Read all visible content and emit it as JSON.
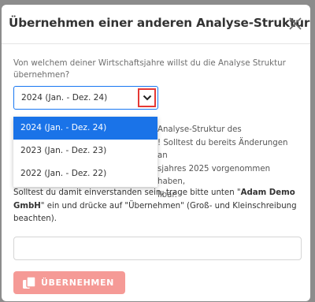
{
  "modal": {
    "title": "Übernehmen einer anderen Analyse-Struktur",
    "question": "Von welchem deiner Wirtschaftsjahre willst du die Analyse Struktur übernehmen?",
    "select": {
      "value": "2024 (Jan. - Dez. 24)",
      "options": [
        "2024 (Jan. - Dez. 24)",
        "2023 (Jan. - Dez. 23)",
        "2022 (Jan. - Dez. 22)"
      ]
    },
    "info": {
      "line1": "Analyse-Struktur des",
      "line2": "! Solltest du bereits Änderungen an",
      "line3": "sjahres 2025 vorgenommen haben,",
      "line4": "llbar."
    },
    "instruction": {
      "part1": "Solltest du damit einverstanden sein, trage bitte unten \"",
      "company": "Adam Demo GmbH",
      "part2": "\" ein und drücke auf \"Übernehmen\" (Groß- und Kleinschreibung beachten)."
    },
    "confirm_input": {
      "value": "",
      "placeholder": ""
    },
    "submit_label": "ÜBERNEHMEN"
  },
  "colors": {
    "accent": "#1877f2",
    "selected_option": "#1a73e8",
    "submit_button": "#f59a96",
    "highlight_border": "#e53935",
    "backdrop": "#8c8c8c"
  },
  "icons": {
    "close": "close-icon",
    "dropdown": "chevron-down-icon",
    "submit": "copy-icon"
  }
}
